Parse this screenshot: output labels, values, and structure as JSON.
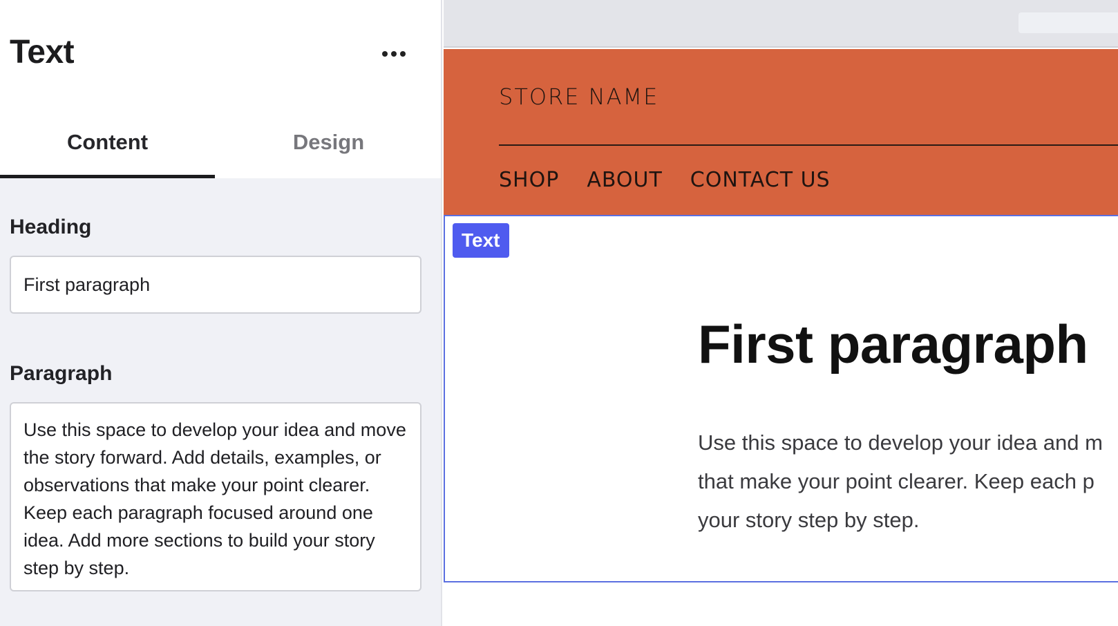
{
  "panel": {
    "title": "Text",
    "more_icon": "more-horizontal-icon",
    "tabs": [
      {
        "label": "Content",
        "active": true
      },
      {
        "label": "Design",
        "active": false
      }
    ],
    "fields": {
      "heading_label": "Heading",
      "heading_value": "First paragraph",
      "paragraph_label": "Paragraph",
      "paragraph_value": "Use this space to develop your idea and move the story forward. Add details, examples, or observations that make your point clearer. Keep each paragraph focused around one idea. Add more sections to build your story step by step."
    }
  },
  "preview": {
    "header": {
      "store_name": "STORE NAME",
      "nav": [
        "SHOP",
        "ABOUT",
        "CONTACT US"
      ],
      "background_color": "#d6633e"
    },
    "selected_badge": "Text",
    "selection_color": "#4f5bef",
    "section": {
      "heading": "First paragraph",
      "paragraph_lines": [
        "Use this space to develop your idea and m",
        "that make your point clearer. Keep each p",
        "your story step by step."
      ]
    }
  }
}
